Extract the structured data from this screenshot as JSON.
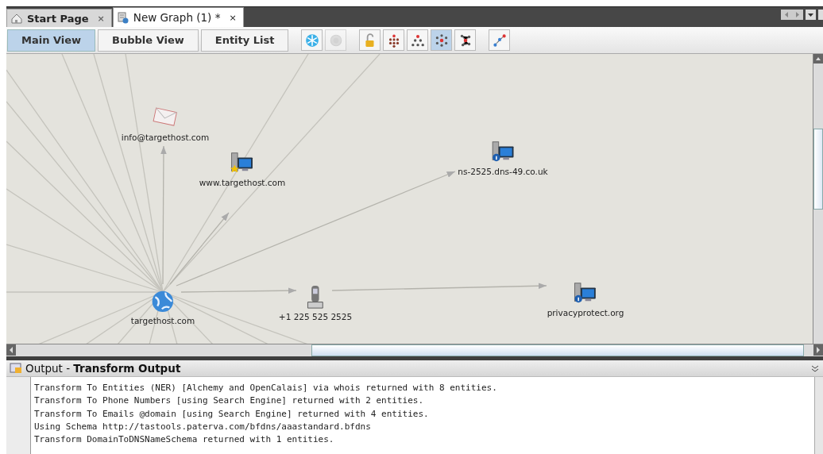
{
  "tabs": [
    {
      "label": "Start Page",
      "kind": "home",
      "close": "×",
      "selected": false
    },
    {
      "label": "New Graph (1) *",
      "kind": "graph",
      "close": "×",
      "selected": true
    }
  ],
  "views": [
    {
      "label": "Main View",
      "selected": true
    },
    {
      "label": "Bubble View",
      "selected": false
    },
    {
      "label": "Entity List",
      "selected": false
    }
  ],
  "toolbar": [
    {
      "kind": "snowflake",
      "selected": false,
      "disabled": false
    },
    {
      "kind": "circle",
      "selected": false,
      "disabled": true
    },
    {
      "kind": "padlock",
      "selected": false,
      "disabled": false
    },
    {
      "kind": "blocks",
      "selected": false,
      "disabled": false
    },
    {
      "kind": "tree",
      "selected": false,
      "disabled": false
    },
    {
      "kind": "radial",
      "selected": true,
      "disabled": false
    },
    {
      "kind": "organic",
      "selected": false,
      "disabled": false
    },
    {
      "kind": "path",
      "selected": false,
      "disabled": false
    }
  ],
  "graph": {
    "nodes": [
      {
        "label": "info@targethost.com",
        "kind": "email"
      },
      {
        "label": "www.targethost.com",
        "kind": "website"
      },
      {
        "label": "ns-2525.dns-49.co.uk",
        "kind": "nameserver"
      },
      {
        "label": "targethost.com",
        "kind": "domain"
      },
      {
        "label": "+1 225 525 2525",
        "kind": "phone"
      },
      {
        "label": "privacyprotect.org",
        "kind": "nameserver"
      }
    ]
  },
  "output": {
    "title": "Output - **Transform Output**",
    "lines": [
      "Transform To Entities (NER) [Alchemy and OpenCalais] via whois returned with 8 entities.",
      "Transform To Phone Numbers [using Search Engine] returned with 2 entities.",
      "Transform To Emails @domain [using Search Engine] returned with 4 entities.",
      "Using Schema http://tastools.paterva.com/bfdns/aaastandard.bfdns",
      "Transform DomainToDNSNameSchema returned with 1 entities."
    ]
  }
}
